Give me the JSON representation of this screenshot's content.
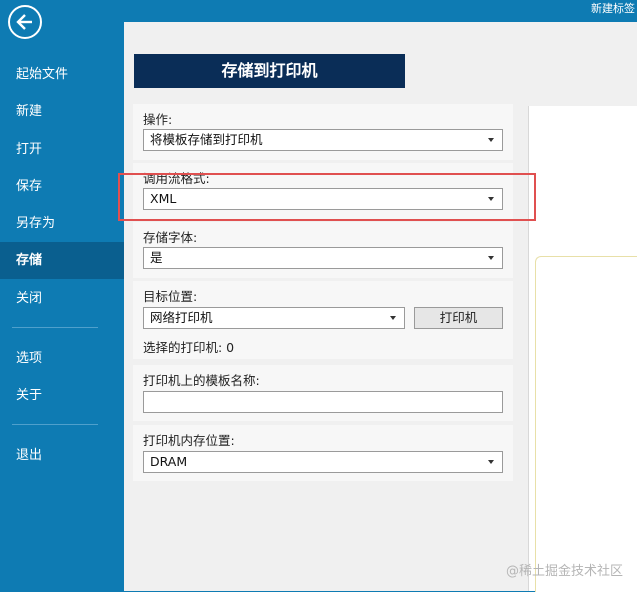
{
  "titlebar": {
    "text": "新建标签"
  },
  "sidebar": {
    "items": [
      {
        "label": "起始文件"
      },
      {
        "label": "新建"
      },
      {
        "label": "打开"
      },
      {
        "label": "保存"
      },
      {
        "label": "另存为"
      },
      {
        "label": "存储"
      },
      {
        "label": "关闭"
      },
      {
        "label": "选项"
      },
      {
        "label": "关于"
      },
      {
        "label": "退出"
      }
    ]
  },
  "header": {
    "title": "存储到打印机"
  },
  "form": {
    "operation": {
      "label": "操作:",
      "value": "将模板存储到打印机"
    },
    "call_format": {
      "label": "调用流格式:",
      "value": "XML"
    },
    "store_fonts": {
      "label": "存储字体:",
      "value": "是"
    },
    "target": {
      "label": "目标位置:",
      "value": "网络打印机",
      "button": "打印机",
      "selected_text": "选择的打印机: 0"
    },
    "template_name": {
      "label": "打印机上的模板名称:",
      "value": ""
    },
    "memory": {
      "label": "打印机内存位置:",
      "value": "DRAM"
    }
  },
  "watermark": "@稀土掘金技术社区"
}
